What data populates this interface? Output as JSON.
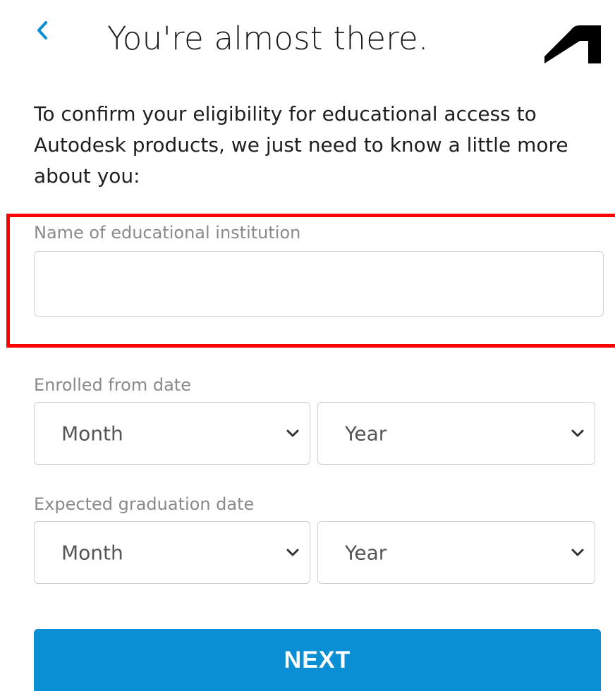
{
  "header": {
    "title": "You're almost there.",
    "back_icon": "chevron-left-icon",
    "logo_icon": "autodesk-logo-icon",
    "accent_color": "#0a8fd4"
  },
  "intro_text": "To confirm your eligibility for educational access to Autodesk products, we just need to know a little more about you:",
  "institution": {
    "label": "Name of educational institution",
    "value": "",
    "placeholder": ""
  },
  "enrolled_from": {
    "label": "Enrolled from date",
    "month": {
      "selected": "Month"
    },
    "year": {
      "selected": "Year"
    }
  },
  "graduation": {
    "label": "Expected graduation date",
    "month": {
      "selected": "Month"
    },
    "year": {
      "selected": "Year"
    }
  },
  "next_button": {
    "label": "NEXT"
  }
}
